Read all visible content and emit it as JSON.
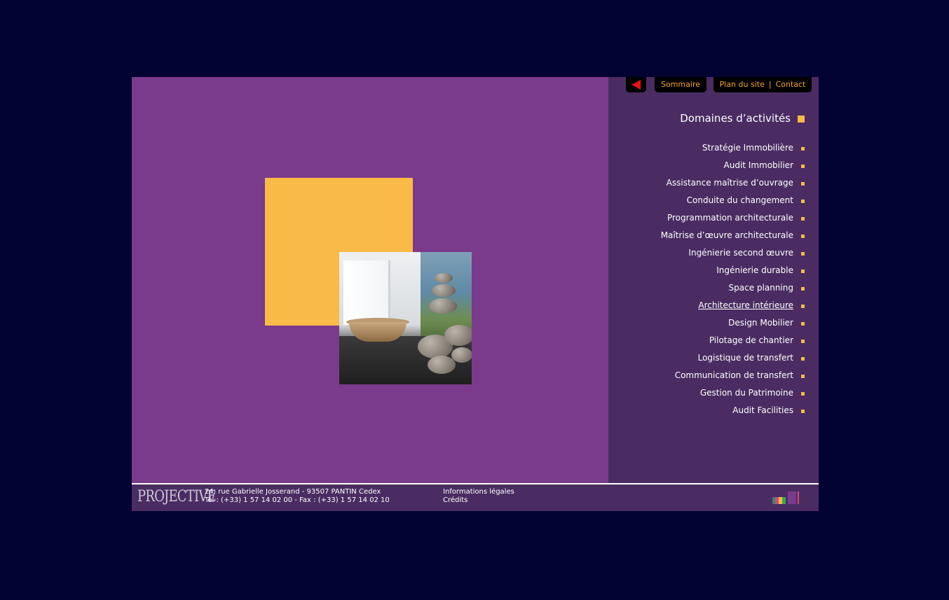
{
  "nav": {
    "sommaire": "Sommaire",
    "plan_du_site": "Plan du site",
    "separator": "|",
    "contact": "Contact"
  },
  "sidebar": {
    "title": "Domaines d’activités",
    "active_index": 9,
    "items": [
      "Stratégie Immobilière",
      "Audit Immobilier",
      "Assistance maîtrise d’ouvrage",
      "Conduite du changement",
      "Programmation architecturale",
      "Maîtrise d’œuvre architecturale",
      "Ingénierie second œuvre",
      "Ingénierie durable",
      "Space planning",
      "Architecture intérieure",
      "Design Mobilier",
      "Pilotage de chantier",
      "Logistique de transfert",
      "Communication de transfert",
      "Gestion du Patrimoine",
      "Audit Facilities"
    ]
  },
  "footer": {
    "logo": "PROJECTIVE",
    "address": "24, rue Gabrielle Josserand - 93507 PANTIN Cedex",
    "phone": "Tél : (+33) 1 57 14 02 00 - Fax : (+33) 1 57 14 02 10",
    "legal": "Informations légales",
    "credits": "Crédits"
  },
  "colors": {
    "background": "#020233",
    "stage": "#7a3b8c",
    "sidebar": "#4a2c62",
    "accent_yellow": "#f9ba48",
    "nav_text": "#f6a623",
    "back_arrow": "#e51212"
  },
  "icons": {
    "back": "back-arrow-icon",
    "bullet": "square-bullet-icon"
  }
}
